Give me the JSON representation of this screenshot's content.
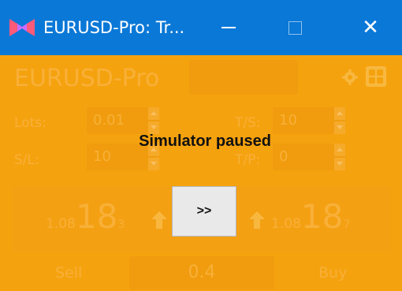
{
  "window": {
    "title": "EURUSD-Pro: Tr...",
    "titlebar_color": "#0a78d7",
    "background_color": "#f5a20f",
    "icons": [
      "app-logo-icon",
      "minimize-icon",
      "maximize-icon",
      "close-icon"
    ],
    "close_glyph": "✕"
  },
  "panel": {
    "symbol": "EURUSD-Pro",
    "lots": {
      "label": "Lots:",
      "value": "0.01"
    },
    "ts": {
      "label": "T/S:",
      "value": "10"
    },
    "sl": {
      "label": "S/L:",
      "value": "10"
    },
    "tp": {
      "label": "T/P:",
      "value": "0"
    },
    "bid": {
      "prefix": "1.08",
      "big": "18",
      "sup": "3"
    },
    "ask": {
      "prefix": "1.08",
      "big": "18",
      "sup": "7"
    },
    "sell_label": "Sell",
    "buy_label": "Buy",
    "lot_size": "0.4"
  },
  "overlay": {
    "message": "Simulator paused",
    "resume_label": ">>"
  }
}
